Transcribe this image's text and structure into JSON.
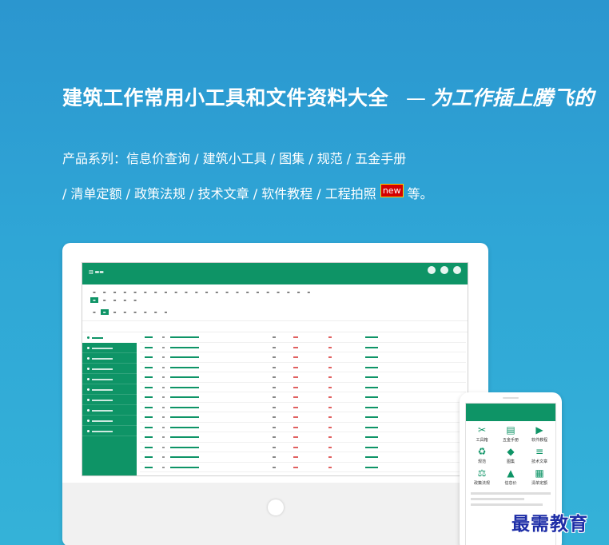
{
  "headline": {
    "title": "建筑工作常用小工具和文件资料大全",
    "dash": "—",
    "slogan": "为工作插上腾飞的"
  },
  "products": {
    "line1": "产品系列：信息价查询 / 建筑小工具 / 图集 / 规范 / 五金手册",
    "line2_pre": "/ 清单定额 / 政策法规 / 技术文章 / 软件教程 / 工程拍照",
    "badge": "new",
    "line2_post": "等。"
  },
  "phone_menu": [
    {
      "label": "工具箱",
      "icon": "tools-icon"
    },
    {
      "label": "五金手册",
      "icon": "book-icon"
    },
    {
      "label": "软件教程",
      "icon": "video-icon"
    },
    {
      "label": "规范",
      "icon": "standard-icon"
    },
    {
      "label": "图集",
      "icon": "atlas-icon"
    },
    {
      "label": "技术文章",
      "icon": "article-icon"
    },
    {
      "label": "政策法规",
      "icon": "law-icon"
    },
    {
      "label": "信息价",
      "icon": "chart-icon"
    },
    {
      "label": "清单定额",
      "icon": "quota-icon"
    }
  ],
  "watermark": "最需教育",
  "colors": {
    "brand_green": "#0e9466",
    "background": "#2fa6d6",
    "badge_red": "#d40000",
    "watermark_blue": "#1d2da6"
  }
}
